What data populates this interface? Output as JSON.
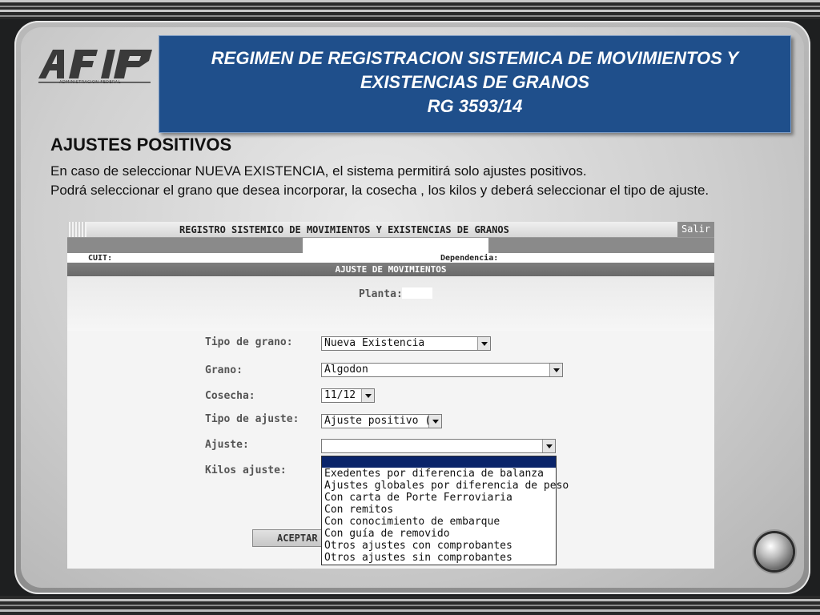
{
  "slide": {
    "logo_text": "AFIP",
    "logo_subtitle": "ADMINISTRACION FEDERAL",
    "title_line1": "REGIMEN DE REGISTRACION SISTEMICA DE MOVIMIENTOS Y",
    "title_line2": "EXISTENCIAS DE GRANOS",
    "title_line3": "RG  3593/14",
    "heading": "AJUSTES POSITIVOS",
    "paragraph1": "En caso de seleccionar NUEVA EXISTENCIA, el sistema permitirá solo ajustes positivos.",
    "paragraph2": "Podrá seleccionar el grano que desea incorporar, la cosecha , los kilos y deberá seleccionar el tipo de ajuste."
  },
  "app": {
    "header_title": "REGISTRO SISTEMICO DE MOVIMIENTOS Y EXISTENCIAS DE GRANOS",
    "salir_label": "Salir",
    "cuit_label": "CUIT:",
    "dependencia_label": "Dependencia:",
    "section_title": "AJUSTE DE MOVIMIENTOS",
    "planta_label": "Planta:",
    "form": {
      "tipo_grano_label": "Tipo de grano:",
      "tipo_grano_value": "Nueva Existencia",
      "grano_label": "Grano:",
      "grano_value": "Algodon",
      "cosecha_label": "Cosecha:",
      "cosecha_value": "11/12",
      "tipo_ajuste_label": "Tipo de ajuste:",
      "tipo_ajuste_value": "Ajuste positivo (+)",
      "ajuste_label": "Ajuste:",
      "ajuste_value": "",
      "kilos_label": "Kilos ajuste:"
    },
    "ajuste_options": [
      "Exedentes por diferencia de balanza",
      "Ajustes globales por diferencia de peso",
      "Con carta de Porte Ferroviaria",
      "Con remitos",
      "Con conocimiento de embarque",
      "Con guía de removido",
      "Otros ajustes con comprobantes",
      "Otros ajustes sin comprobantes"
    ],
    "accept_label": "ACEPTAR"
  },
  "colors": {
    "title_bg": "#1f4f8b",
    "dropdown_highlight": "#0a246a",
    "section_bar": "#6e6e6e"
  }
}
